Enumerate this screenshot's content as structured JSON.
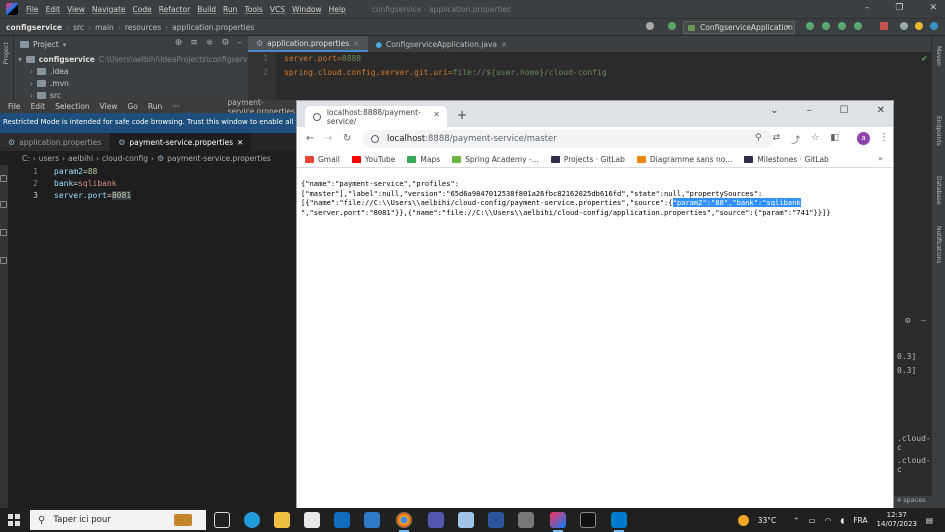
{
  "intellij": {
    "menu": [
      "File",
      "Edit",
      "View",
      "Navigate",
      "Code",
      "Refactor",
      "Build",
      "Run",
      "Tools",
      "VCS",
      "Window",
      "Help"
    ],
    "window_title": "configservice - application.properties",
    "breadcrumb": [
      "configservice",
      "src",
      "main",
      "resources",
      "application.properties"
    ],
    "run_config": "ConfigserviceApplication",
    "project_label": "Project",
    "left_strip_label": "Project",
    "tree": {
      "root_name": "configservice",
      "root_path": "C:\\Users\\aelbihi\\IdeaProjects\\configservice",
      "items": [
        ".idea",
        ".mvn",
        "src"
      ]
    },
    "tabs": [
      {
        "label": "application.properties",
        "active": true
      },
      {
        "label": "ConfigserviceApplication.java",
        "active": false
      }
    ],
    "editor_lines": [
      {
        "num": "1",
        "key": "server.port",
        "value": "8888"
      },
      {
        "num": "2",
        "key": "spring.cloud.config.server.git.uri",
        "value": "file://${user.home}/cloud-config"
      }
    ],
    "right_strip_labels": [
      "Maven",
      "Endpoints",
      "Database",
      "Notifications"
    ],
    "console_fragments": [
      "0.3]",
      "0.3]",
      ".cloud-c",
      ".cloud-c"
    ],
    "status_spaces": "4 spaces"
  },
  "vscode": {
    "menu": [
      "File",
      "Edit",
      "Selection",
      "View",
      "Go",
      "Run",
      "···"
    ],
    "window_title": "payment-service.properties",
    "banner": "Restricted Mode is intended for safe code browsing. Trust this window to enable all featur",
    "tabs": [
      {
        "label": "application.properties",
        "active": false
      },
      {
        "label": "payment-service.properties",
        "active": true,
        "close": "✕"
      }
    ],
    "breadcrumb": [
      "C:",
      "users",
      "aelbihi",
      "cloud-config",
      "payment-service.properties"
    ],
    "lines": [
      {
        "num": "1",
        "key": "param2",
        "value": "88"
      },
      {
        "num": "2",
        "key": "bank",
        "value": "sqlibank"
      },
      {
        "num": "3",
        "key": "server.port",
        "value": "8081"
      }
    ]
  },
  "chrome": {
    "tab_title": "localhost:8888/payment-service/",
    "url_host": "localhost",
    "url_rest": ":8888/payment-service/master",
    "avatar_letter": "a",
    "bookmarks": [
      {
        "label": "Gmail",
        "color": "#ea4335"
      },
      {
        "label": "YouTube",
        "color": "#ff0000"
      },
      {
        "label": "Maps",
        "color": "#34a853"
      },
      {
        "label": "Spring Academy -...",
        "color": "#6db33f"
      },
      {
        "label": "Projects · GitLab",
        "color": "#2e2e48"
      },
      {
        "label": "Diagramme sans no...",
        "color": "#f08705"
      },
      {
        "label": "Milestones · GitLab",
        "color": "#2e2e48"
      }
    ],
    "json_before": "{\"name\":\"payment-service\",\"profiles\":\n[\"master\"],\"label\":null,\"version\":\"65d6a9847012538f801a26fbc82162025db616fd\",\"state\":null,\"propertySources\":\n[{\"name\":\"file://C:\\\\Users\\\\aelbihi/cloud-config/payment-service.properties\",\"source\":{",
    "json_selected": "\"param2\":\"88\",\"bank\":\"sqlibank",
    "json_after": "\n\",\"server.port\":\"8081\"}},{\"name\":\"file://C:\\\\Users\\\\aelbihi/cloud-config/application.properties\",\"source\":{\"param\":\"741\"}}]}"
  },
  "taskbar": {
    "search_placeholder": "Taper ici pour",
    "temperature": "33°C",
    "language": "FRA",
    "time": "12:37",
    "date": "14/07/2023"
  },
  "colors": {
    "selection": "#3390ff",
    "vscode_banner": "#1e4e7e",
    "intellij_bg": "#2b2b2b"
  }
}
